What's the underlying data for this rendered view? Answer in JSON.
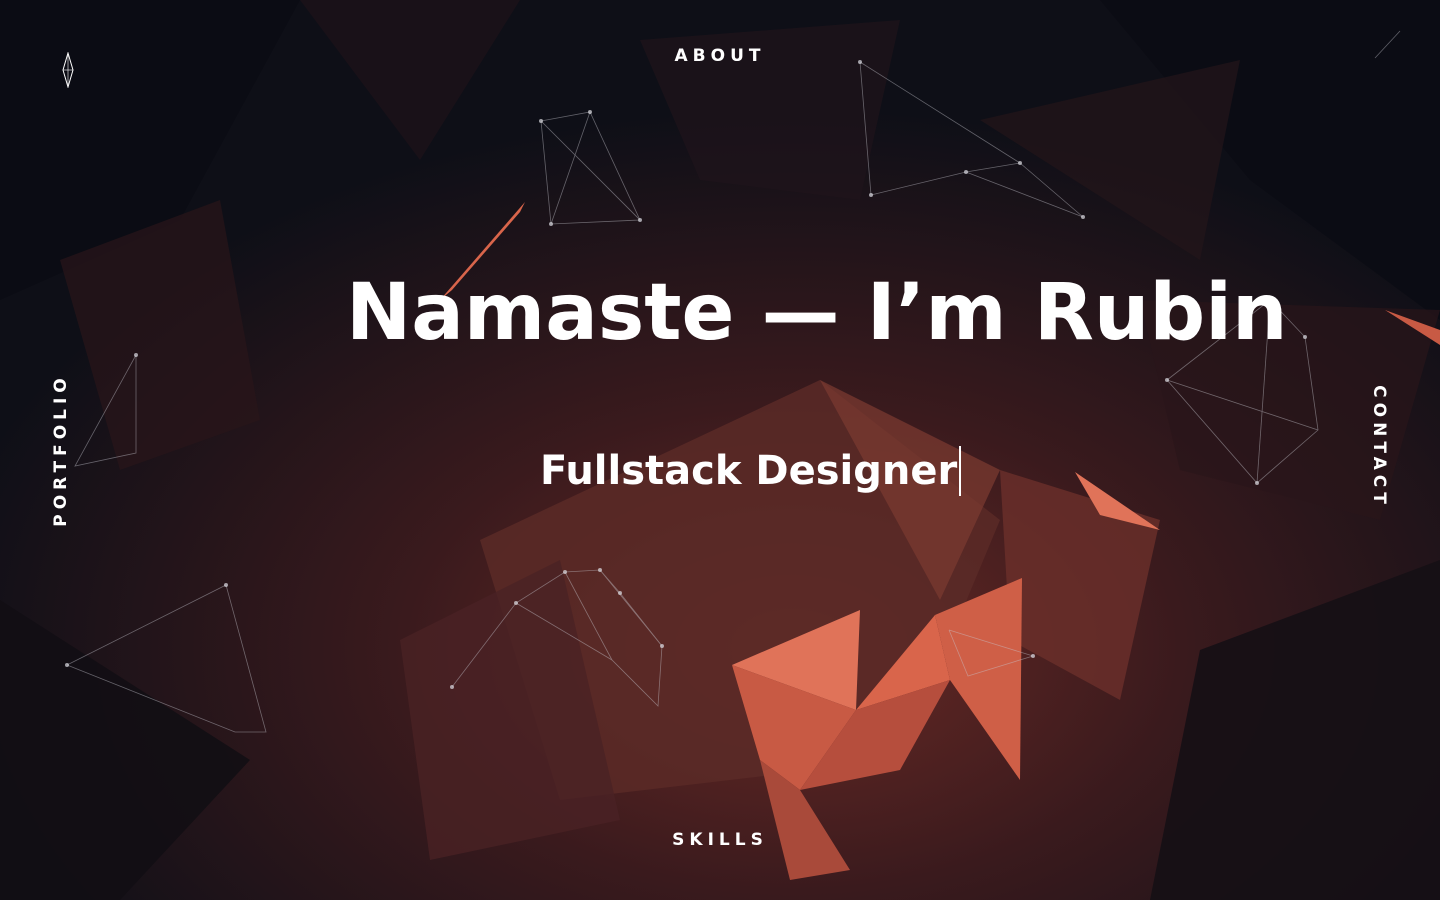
{
  "nav": {
    "about": "ABOUT",
    "portfolio": "PORTFOLIO",
    "contact": "CONTACT",
    "skills": "SKILLS"
  },
  "hero": {
    "title": "Namaste — I’m Rubin",
    "subtitle": "Fullstack Designer"
  },
  "colors": {
    "background": "#0e0f17",
    "accent": "#d9654b",
    "text": "#ffffff"
  },
  "icons": {
    "logo": "diamond-logo-icon"
  }
}
